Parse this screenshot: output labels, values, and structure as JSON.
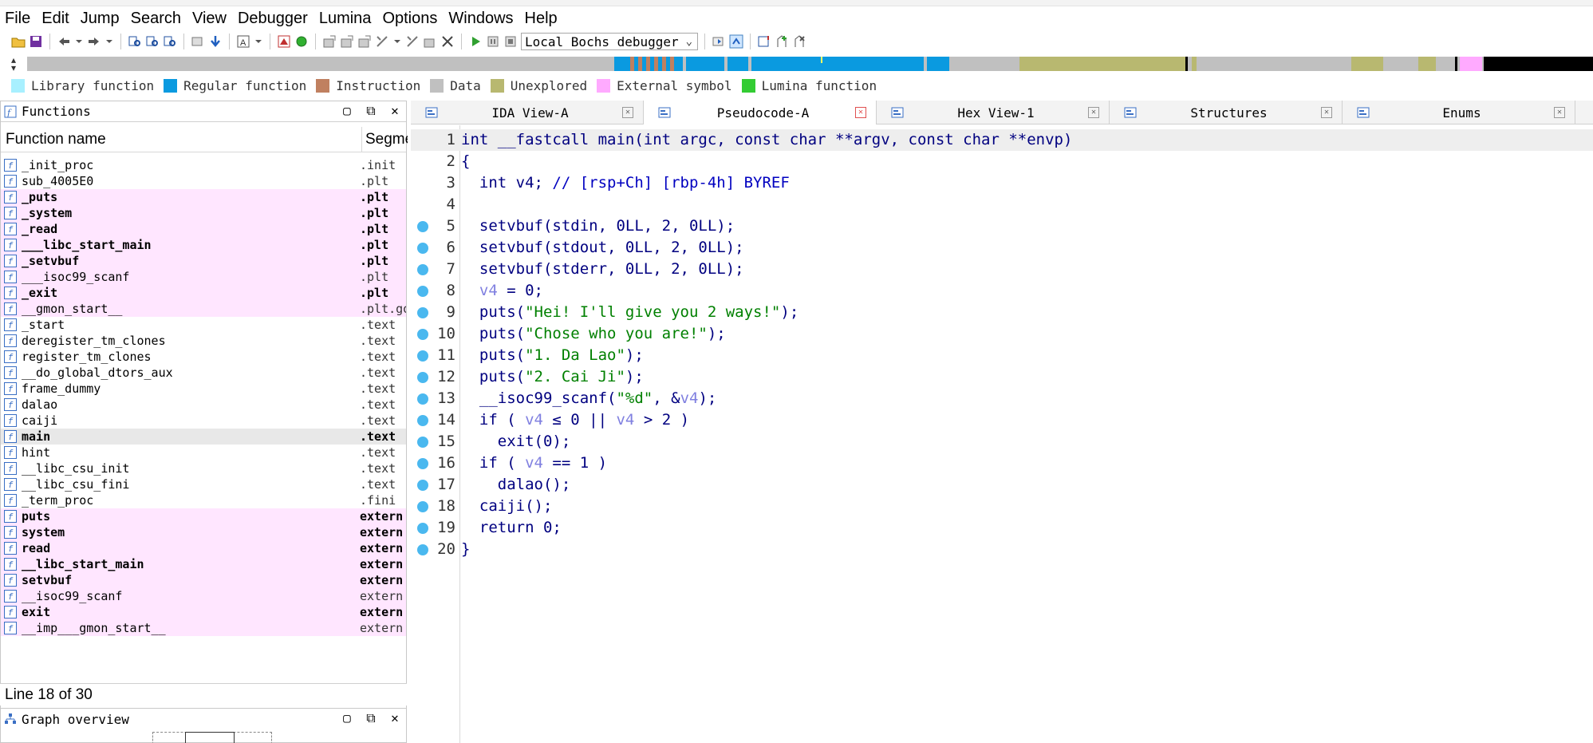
{
  "menu": [
    "File",
    "Edit",
    "Jump",
    "Search",
    "View",
    "Debugger",
    "Lumina",
    "Options",
    "Windows",
    "Help"
  ],
  "toolbar": {
    "debugger_select": "Local Bochs debugger"
  },
  "navband_colors": {
    "regular": "#0a9ae0",
    "instruction": "#c08060",
    "data": "#c0c0c0",
    "unexplored": "#b8b870",
    "external": "#ffaaff",
    "black": "#000000"
  },
  "legend": [
    {
      "label": "Library function",
      "color": "#a8f0ff"
    },
    {
      "label": "Regular function",
      "color": "#0a9ae0"
    },
    {
      "label": "Instruction",
      "color": "#c08060"
    },
    {
      "label": "Data",
      "color": "#c0c0c0"
    },
    {
      "label": "Unexplored",
      "color": "#b8b870"
    },
    {
      "label": "External symbol",
      "color": "#ffaaff"
    },
    {
      "label": "Lumina function",
      "color": "#33cc33"
    }
  ],
  "functions_panel": {
    "title": "Functions",
    "col_name": "Function name",
    "col_segment": "Segme",
    "rows": [
      {
        "name": "_init_proc",
        "seg": ".init",
        "pink": false,
        "bold": false
      },
      {
        "name": "sub_4005E0",
        "seg": ".plt",
        "pink": false,
        "bold": false
      },
      {
        "name": "_puts",
        "seg": ".plt",
        "pink": true,
        "bold": true
      },
      {
        "name": "_system",
        "seg": ".plt",
        "pink": true,
        "bold": true
      },
      {
        "name": "_read",
        "seg": ".plt",
        "pink": true,
        "bold": true
      },
      {
        "name": "___libc_start_main",
        "seg": ".plt",
        "pink": true,
        "bold": true
      },
      {
        "name": "_setvbuf",
        "seg": ".plt",
        "pink": true,
        "bold": true
      },
      {
        "name": "___isoc99_scanf",
        "seg": ".plt",
        "pink": true,
        "bold": false
      },
      {
        "name": "_exit",
        "seg": ".plt",
        "pink": true,
        "bold": true
      },
      {
        "name": "__gmon_start__",
        "seg": ".plt.go",
        "pink": true,
        "bold": false
      },
      {
        "name": "_start",
        "seg": ".text",
        "pink": false,
        "bold": false
      },
      {
        "name": "deregister_tm_clones",
        "seg": ".text",
        "pink": false,
        "bold": false
      },
      {
        "name": "register_tm_clones",
        "seg": ".text",
        "pink": false,
        "bold": false
      },
      {
        "name": "__do_global_dtors_aux",
        "seg": ".text",
        "pink": false,
        "bold": false
      },
      {
        "name": "frame_dummy",
        "seg": ".text",
        "pink": false,
        "bold": false
      },
      {
        "name": "dalao",
        "seg": ".text",
        "pink": false,
        "bold": false
      },
      {
        "name": "caiji",
        "seg": ".text",
        "pink": false,
        "bold": false
      },
      {
        "name": "main",
        "seg": ".text",
        "pink": false,
        "bold": true,
        "selected": true
      },
      {
        "name": "hint",
        "seg": ".text",
        "pink": false,
        "bold": false
      },
      {
        "name": "__libc_csu_init",
        "seg": ".text",
        "pink": false,
        "bold": false
      },
      {
        "name": "__libc_csu_fini",
        "seg": ".text",
        "pink": false,
        "bold": false
      },
      {
        "name": "_term_proc",
        "seg": ".fini",
        "pink": false,
        "bold": false
      },
      {
        "name": "puts",
        "seg": "extern",
        "pink": true,
        "bold": true
      },
      {
        "name": "system",
        "seg": "extern",
        "pink": true,
        "bold": true
      },
      {
        "name": "read",
        "seg": "extern",
        "pink": true,
        "bold": true
      },
      {
        "name": "__libc_start_main",
        "seg": "extern",
        "pink": true,
        "bold": true
      },
      {
        "name": "setvbuf",
        "seg": "extern",
        "pink": true,
        "bold": true
      },
      {
        "name": "__isoc99_scanf",
        "seg": "extern",
        "pink": true,
        "bold": false
      },
      {
        "name": "exit",
        "seg": "extern",
        "pink": true,
        "bold": true
      },
      {
        "name": "__imp___gmon_start__",
        "seg": "extern",
        "pink": true,
        "bold": false
      }
    ],
    "status": "Line 18 of 30"
  },
  "graph_panel": {
    "title": "Graph overview"
  },
  "tabs": [
    {
      "label": "IDA View-A",
      "active": false
    },
    {
      "label": "Pseudocode-A",
      "active": true
    },
    {
      "label": "Hex View-1",
      "active": false
    },
    {
      "label": "Structures",
      "active": false
    },
    {
      "label": "Enums",
      "active": false
    }
  ],
  "code": [
    {
      "n": "1",
      "bp": false,
      "parts": [
        [
          "k",
          "int __fastcall main(int argc, const char **argv, const char **envp)"
        ]
      ]
    },
    {
      "n": "2",
      "bp": false,
      "parts": [
        [
          "k",
          "{"
        ]
      ]
    },
    {
      "n": "3",
      "bp": false,
      "parts": [
        [
          "k",
          "  int v4; "
        ],
        [
          "c",
          "// [rsp+Ch] [rbp-4h] BYREF"
        ]
      ]
    },
    {
      "n": "4",
      "bp": false,
      "parts": [
        [
          "k",
          ""
        ]
      ]
    },
    {
      "n": "5",
      "bp": true,
      "parts": [
        [
          "k",
          "  setvbuf(stdin, 0LL, 2, 0LL);"
        ]
      ]
    },
    {
      "n": "6",
      "bp": true,
      "parts": [
        [
          "k",
          "  setvbuf(stdout, 0LL, 2, 0LL);"
        ]
      ]
    },
    {
      "n": "7",
      "bp": true,
      "parts": [
        [
          "k",
          "  setvbuf(stderr, 0LL, 2, 0LL);"
        ]
      ]
    },
    {
      "n": "8",
      "bp": true,
      "parts": [
        [
          "k",
          "  "
        ],
        [
          "v",
          "v4"
        ],
        [
          "k",
          " = 0;"
        ]
      ]
    },
    {
      "n": "9",
      "bp": true,
      "parts": [
        [
          "k",
          "  puts("
        ],
        [
          "s",
          "\"Hei! I'll give you 2 ways!\""
        ],
        [
          "k",
          ");"
        ]
      ]
    },
    {
      "n": "10",
      "bp": true,
      "parts": [
        [
          "k",
          "  puts("
        ],
        [
          "s",
          "\"Chose who you are!\""
        ],
        [
          "k",
          ");"
        ]
      ]
    },
    {
      "n": "11",
      "bp": true,
      "parts": [
        [
          "k",
          "  puts("
        ],
        [
          "s",
          "\"1. Da Lao\""
        ],
        [
          "k",
          ");"
        ]
      ]
    },
    {
      "n": "12",
      "bp": true,
      "parts": [
        [
          "k",
          "  puts("
        ],
        [
          "s",
          "\"2. Cai Ji\""
        ],
        [
          "k",
          ");"
        ]
      ]
    },
    {
      "n": "13",
      "bp": true,
      "parts": [
        [
          "k",
          "  __isoc99_scanf("
        ],
        [
          "s",
          "\"%d\""
        ],
        [
          "k",
          ", &"
        ],
        [
          "v",
          "v4"
        ],
        [
          "k",
          ");"
        ]
      ]
    },
    {
      "n": "14",
      "bp": true,
      "parts": [
        [
          "k",
          "  if ( "
        ],
        [
          "v",
          "v4"
        ],
        [
          "k",
          " ≤ 0 || "
        ],
        [
          "v",
          "v4"
        ],
        [
          "k",
          " > 2 )"
        ]
      ]
    },
    {
      "n": "15",
      "bp": true,
      "parts": [
        [
          "k",
          "    exit(0);"
        ]
      ]
    },
    {
      "n": "16",
      "bp": true,
      "parts": [
        [
          "k",
          "  if ( "
        ],
        [
          "v",
          "v4"
        ],
        [
          "k",
          " == 1 )"
        ]
      ]
    },
    {
      "n": "17",
      "bp": true,
      "parts": [
        [
          "k",
          "    dalao();"
        ]
      ]
    },
    {
      "n": "18",
      "bp": true,
      "parts": [
        [
          "k",
          "  caiji();"
        ]
      ]
    },
    {
      "n": "19",
      "bp": true,
      "parts": [
        [
          "k",
          "  return 0;"
        ]
      ]
    },
    {
      "n": "20",
      "bp": true,
      "parts": [
        [
          "k",
          "}"
        ]
      ]
    }
  ]
}
